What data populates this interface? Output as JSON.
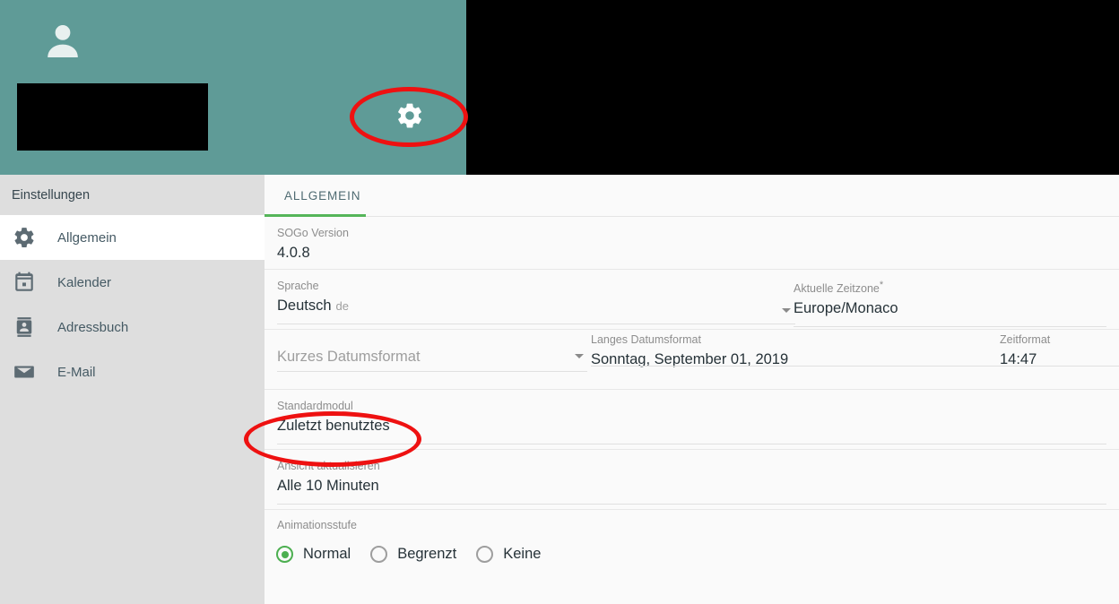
{
  "theme": {
    "banner_teal": "#5f9b97",
    "sidebar_gray": "#dedede",
    "main_bg": "#fafafa",
    "accent_green": "#55b559",
    "radio_green": "#4caf50",
    "annotation_red": "#ee1111",
    "label_gray": "#8d8d8d",
    "value_dark": "#263238"
  },
  "banner": {
    "avatar_icon": "person-icon",
    "gear_icon": "gear-icon",
    "redaction_label": "redacted-block"
  },
  "annotations": [
    {
      "name": "gear-highlight",
      "shape": "ellipse",
      "color": "#ee1111"
    },
    {
      "name": "default-module-highlight",
      "shape": "ellipse",
      "color": "#ee1111"
    }
  ],
  "sidebar": {
    "header": "Einstellungen",
    "items": [
      {
        "label": "Allgemein",
        "icon": "gear-icon",
        "active": true
      },
      {
        "label": "Kalender",
        "icon": "calendar-icon",
        "active": false
      },
      {
        "label": "Adressbuch",
        "icon": "contact-card-icon",
        "active": false
      },
      {
        "label": "E-Mail",
        "icon": "envelope-icon",
        "active": false
      }
    ]
  },
  "main": {
    "tabs": [
      {
        "label": "ALLGEMEIN",
        "selected": true
      }
    ],
    "fields": {
      "sogo_version": {
        "label": "SOGo Version",
        "value": "4.0.8"
      },
      "language": {
        "label": "Sprache",
        "value": "Deutsch",
        "suffix": "de",
        "has_caret": true
      },
      "timezone": {
        "label": "Aktuelle Zeitzone",
        "required_marker": "*",
        "value": "Europe/Monaco"
      },
      "short_date_format": {
        "label": "",
        "placeholder": "Kurzes Datumsformat",
        "has_caret": true
      },
      "long_date_format": {
        "label": "Langes Datumsformat",
        "value": "Sonntag, September 01, 2019",
        "has_caret": true
      },
      "time_format": {
        "label": "Zeitformat",
        "value": "14:47"
      },
      "default_module": {
        "label": "Standardmodul",
        "value": "Zuletzt benutztes"
      },
      "refresh_view": {
        "label": "Ansicht aktualisieren",
        "value": "Alle 10 Minuten"
      },
      "animation_level": {
        "label": "Animationsstufe",
        "options": [
          {
            "label": "Normal",
            "checked": true
          },
          {
            "label": "Begrenzt",
            "checked": false
          },
          {
            "label": "Keine",
            "checked": false
          }
        ]
      }
    }
  }
}
